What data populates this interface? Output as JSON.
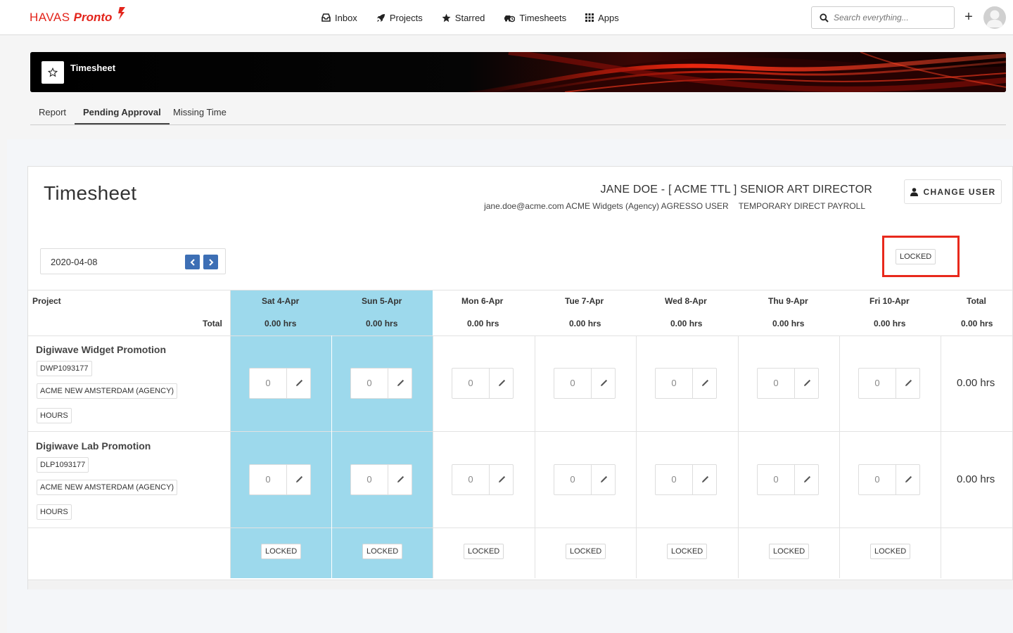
{
  "brand": {
    "name_part1": "HAVAS",
    "name_part2": "Pronto"
  },
  "nav": {
    "items": [
      {
        "label": "Inbox",
        "icon": "inbox-icon"
      },
      {
        "label": "Projects",
        "icon": "rocket-icon"
      },
      {
        "label": "Starred",
        "icon": "star-icon"
      },
      {
        "label": "Timesheets",
        "icon": "car-clock-icon"
      },
      {
        "label": "Apps",
        "icon": "grid-icon"
      }
    ],
    "search_placeholder": "Search everything...",
    "plus_label": "+"
  },
  "banner": {
    "title": "Timesheet"
  },
  "subtabs": [
    {
      "label": "Report"
    },
    {
      "label": "Pending Approval",
      "active": true
    },
    {
      "label": "Missing Time"
    }
  ],
  "card": {
    "title": "Timesheet",
    "user_name": "JANE DOE - [ ACME TTL ] SENIOR ART DIRECTOR",
    "user_email_line": "jane.doe@acme.com ACME Widgets (Agency) AGRESSO USER",
    "user_payroll": "TEMPORARY DIRECT PAYROLL",
    "change_user_label": "CHANGE USER",
    "date_value": "2020-04-08",
    "status_label": "LOCKED"
  },
  "grid": {
    "project_header": "Project",
    "total_label": "Total",
    "total_column_header": "Total",
    "total_column_value": "0.00 hrs",
    "days": [
      {
        "label": "Sat 4-Apr",
        "total": "0.00 hrs",
        "weekend": true,
        "status": "LOCKED"
      },
      {
        "label": "Sun 5-Apr",
        "total": "0.00 hrs",
        "weekend": true,
        "status": "LOCKED"
      },
      {
        "label": "Mon 6-Apr",
        "total": "0.00 hrs",
        "weekend": false,
        "status": "LOCKED"
      },
      {
        "label": "Tue 7-Apr",
        "total": "0.00 hrs",
        "weekend": false,
        "status": "LOCKED"
      },
      {
        "label": "Wed 8-Apr",
        "total": "0.00 hrs",
        "weekend": false,
        "status": "LOCKED"
      },
      {
        "label": "Thu 9-Apr",
        "total": "0.00 hrs",
        "weekend": false,
        "status": "LOCKED"
      },
      {
        "label": "Fri 10-Apr",
        "total": "0.00 hrs",
        "weekend": false,
        "status": "LOCKED"
      }
    ],
    "projects": [
      {
        "name": "Digiwave Widget Promotion",
        "code": "DWP1093177",
        "agency": "ACME NEW AMSTERDAM (AGENCY)",
        "type": "HOURS",
        "entries": [
          "0",
          "0",
          "0",
          "0",
          "0",
          "0",
          "0"
        ],
        "total": "0.00 hrs"
      },
      {
        "name": "Digiwave Lab Promotion",
        "code": "DLP1093177",
        "agency": "ACME NEW AMSTERDAM (AGENCY)",
        "type": "HOURS",
        "entries": [
          "0",
          "0",
          "0",
          "0",
          "0",
          "0",
          "0"
        ],
        "total": "0.00 hrs"
      }
    ]
  },
  "colors": {
    "brand_red": "#e3241b",
    "weekend_blue": "#9dd9ec",
    "nav_arrow_blue": "#3d6fb5",
    "highlight_red": "#e8291c"
  }
}
